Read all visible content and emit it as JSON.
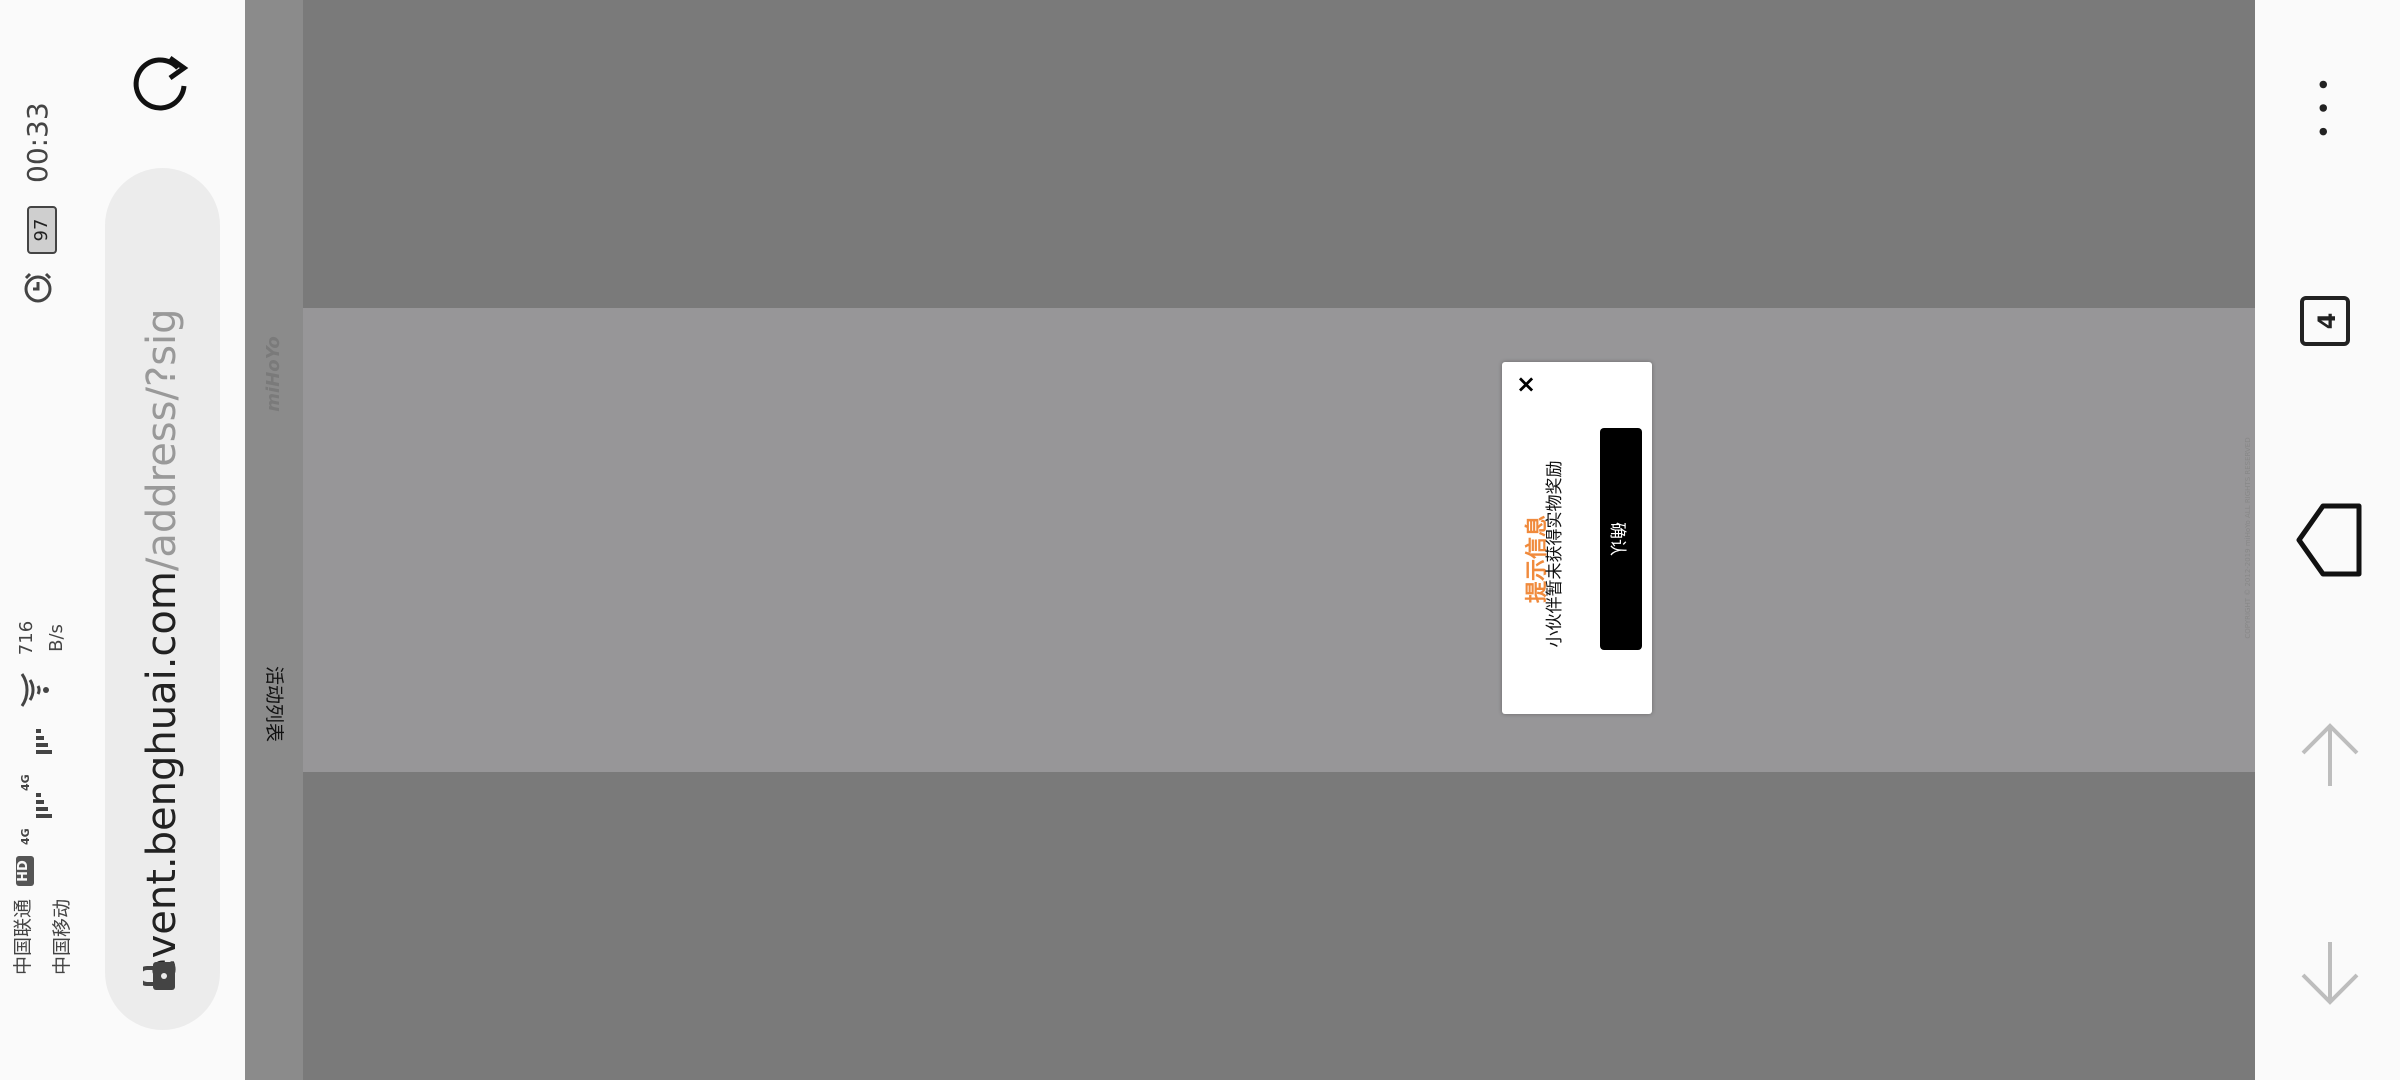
{
  "status_bar": {
    "carrier_1": "中国联通",
    "hd_badge": "HD",
    "carrier_2": "中国移动",
    "network_1": "4G",
    "network_2": "4G",
    "net_speed_value": "716",
    "net_speed_unit": "B/s",
    "battery": "97",
    "time": "00:33"
  },
  "browser": {
    "url_domain": "event.benghuai.com",
    "url_path": "/address/?sig",
    "tab_count": "4",
    "more_glyph": "• • •"
  },
  "page": {
    "sidebar_logo": "miHoYo",
    "sidebar_menu": "活动列表",
    "copyright": "COPYRIGHT © 2012-2019 miHoYo ALL RIGHTS RESERVED"
  },
  "dialog": {
    "title": "提示信息",
    "message": "小伙伴暂未获得实物奖励",
    "confirm_label": "确认",
    "close_glyph": "×"
  },
  "colors": {
    "dialog_title": "#f08a3c",
    "overlay": "#979698",
    "confirm_button": "#000000"
  }
}
